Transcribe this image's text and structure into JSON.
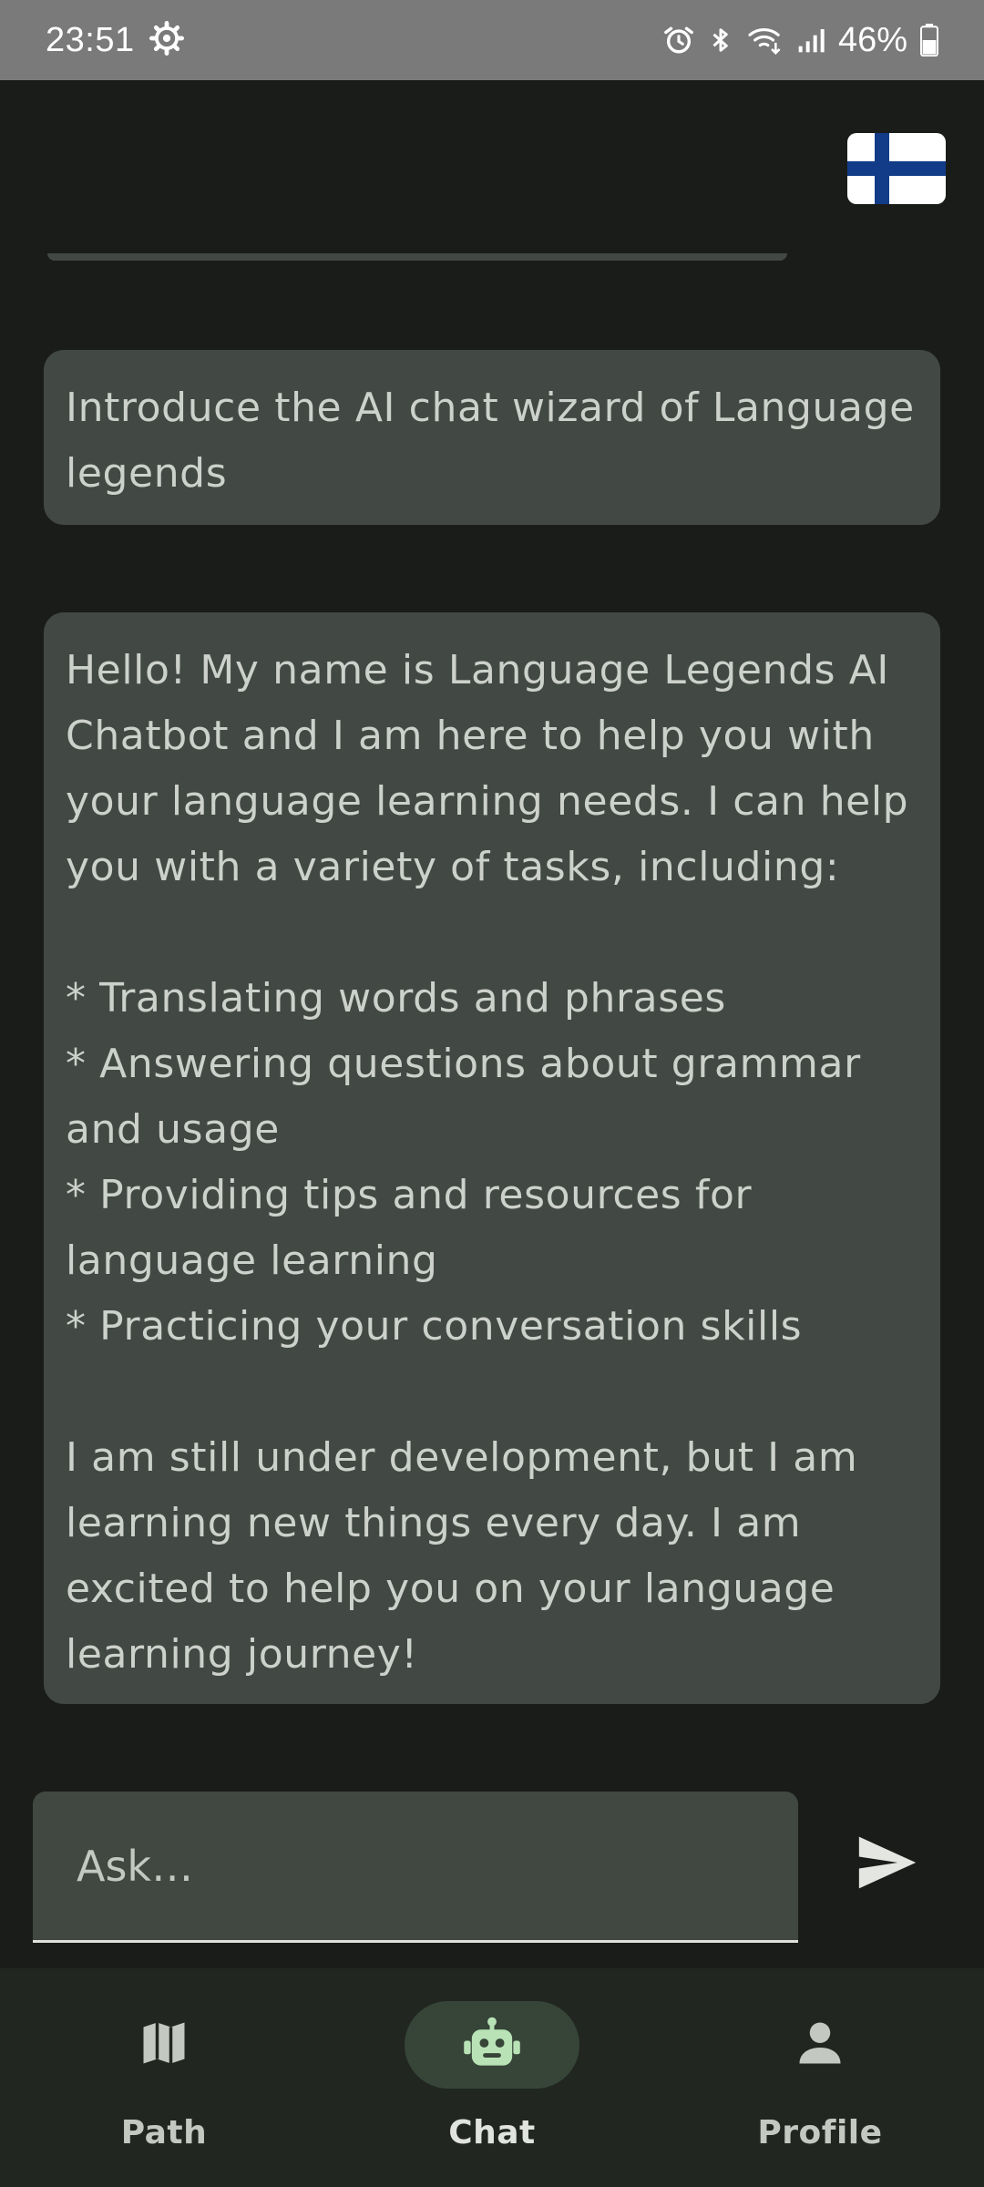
{
  "status_bar": {
    "time": "23:51",
    "battery": "46%",
    "icons": [
      "settings-gear-icon",
      "alarm-icon",
      "bluetooth-icon",
      "wifi-icon",
      "signal-icon",
      "battery-icon"
    ]
  },
  "top_bar": {
    "flag": "finland-flag-icon"
  },
  "messages": [
    {
      "role": "user",
      "text": "Introduce the AI chat wizard of Language\nlegends"
    },
    {
      "role": "bot",
      "text": "Hello! My name is Language Legends AI\nChatbot and I am here to help you with\nyour language learning needs. I can help\nyou with a variety of tasks, including:\n\n* Translating words and phrases\n* Answering questions about grammar\nand usage\n* Providing tips and resources for\nlanguage learning\n* Practicing your conversation skills\n\nI am still under development, but I am\nlearning new things every day. I am\nexcited to help you on your language\nlearning journey!"
    }
  ],
  "input": {
    "placeholder": "Ask…",
    "value": ""
  },
  "send": {
    "icon": "send-icon"
  },
  "nav": {
    "items": [
      {
        "label": "Path",
        "icon": "map-icon",
        "active": false
      },
      {
        "label": "Chat",
        "icon": "robot-icon",
        "active": true
      },
      {
        "label": "Profile",
        "icon": "person-icon",
        "active": false
      }
    ]
  },
  "colors": {
    "background": "#1a1c1a",
    "bubble": "#424843",
    "text": "#cdd1cb",
    "nav_background": "#212621",
    "nav_active_pill": "#364537",
    "status_bar": "#7a7a7a",
    "flag_blue": "#123c87"
  }
}
